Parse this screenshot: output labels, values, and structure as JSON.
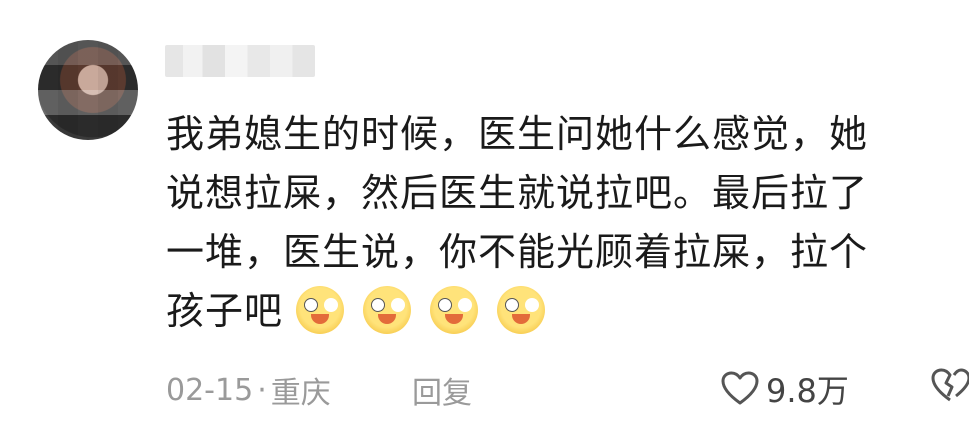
{
  "comment": {
    "lines": [
      "我弟媳生的时候，医生问她什么感觉，她",
      "说想拉屎，然后医生就说拉吧。最后拉了",
      "一堆，医生说，你不能光顾着拉屎，拉个",
      "孩子吧"
    ],
    "emoji_count": 4,
    "emoji_icon": "crying-laughing-emoji-icon"
  },
  "meta": {
    "date": "02-15",
    "separator": "·",
    "location": "重庆",
    "reply_label": "回复",
    "like_count": "9.8万"
  },
  "icons": {
    "like": "heart-outline-icon",
    "dislike": "broken-heart-icon"
  }
}
